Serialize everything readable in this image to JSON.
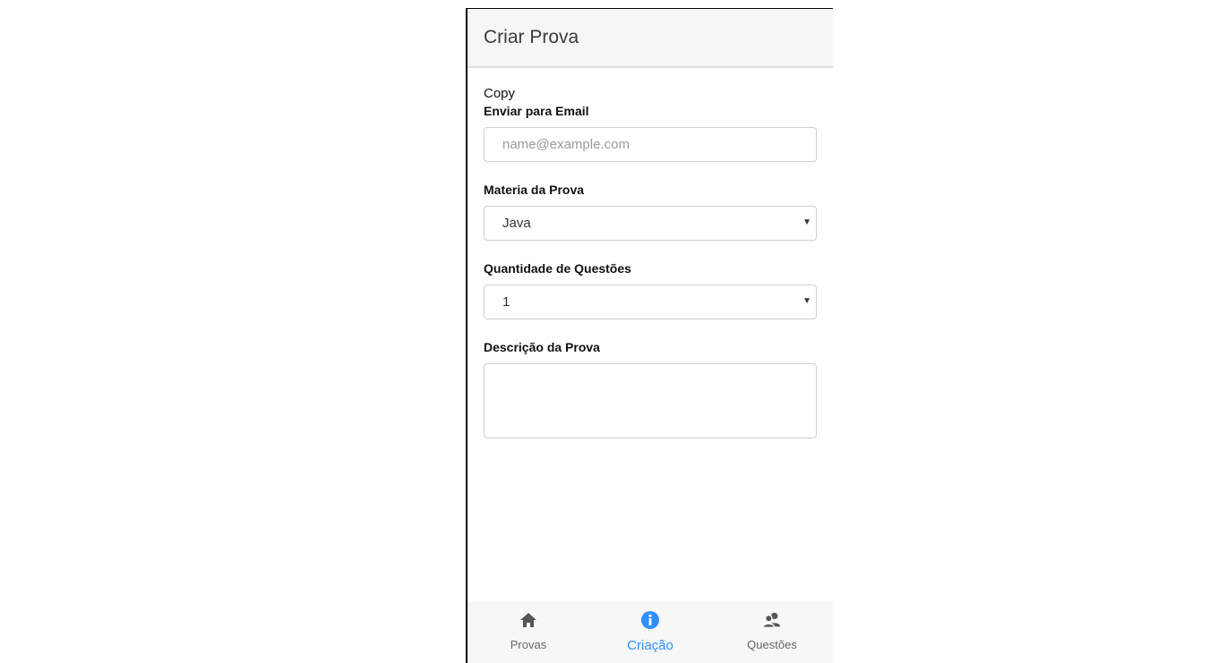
{
  "header": {
    "title": "Criar Prova"
  },
  "form": {
    "copy_text": "Copy",
    "email": {
      "label": "Enviar para Email",
      "placeholder": "name@example.com",
      "value": ""
    },
    "materia": {
      "label": "Materia da Prova",
      "value": "Java"
    },
    "quantidade": {
      "label": "Quantidade de Questões",
      "value": "1"
    },
    "descricao": {
      "label": "Descrição da Prova",
      "value": ""
    }
  },
  "tabbar": {
    "active_color": "#2f8fff",
    "items": [
      {
        "label": "Provas",
        "icon": "home-icon"
      },
      {
        "label": "Criação",
        "icon": "info-icon",
        "active": true
      },
      {
        "label": "Questões",
        "icon": "users-icon"
      }
    ]
  }
}
